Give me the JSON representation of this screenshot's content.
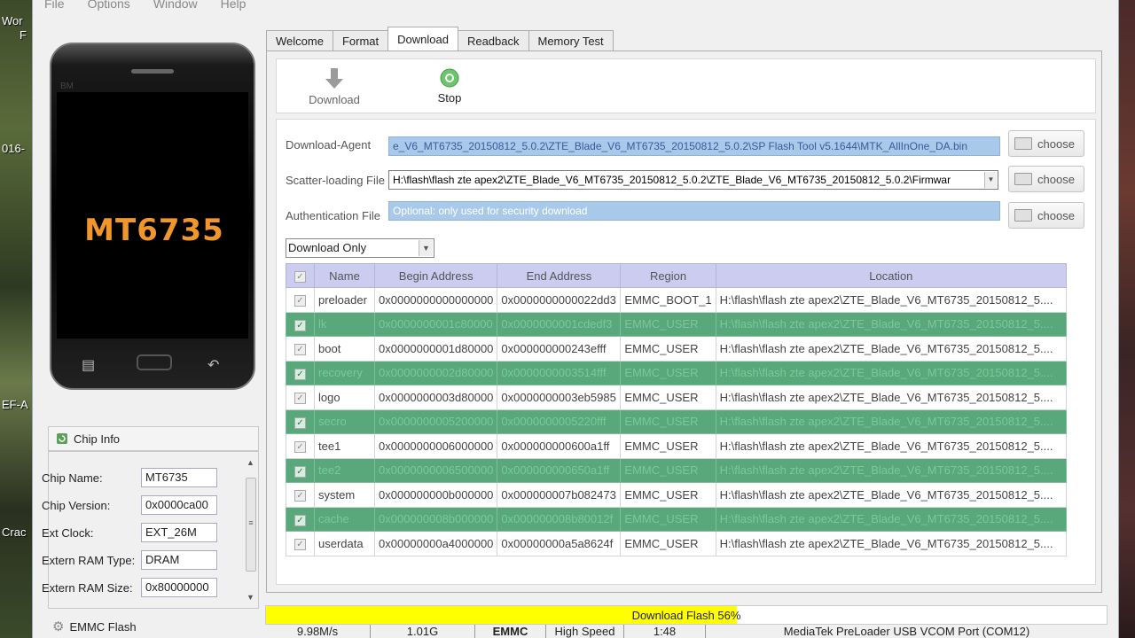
{
  "menu": [
    "File",
    "Options",
    "Window",
    "Help"
  ],
  "desktop": {
    "left_texts": [
      "Wor",
      "F",
      "016-",
      "EF-A",
      "Crac"
    ]
  },
  "phone": {
    "model": "MT6735",
    "brand": "BM"
  },
  "chip_info": {
    "title": "Chip Info",
    "fields": [
      {
        "label": "Chip Name:",
        "value": "MT6735"
      },
      {
        "label": "Chip Version:",
        "value": "0x0000ca00"
      },
      {
        "label": "Ext Clock:",
        "value": "EXT_26M"
      },
      {
        "label": "Extern RAM Type:",
        "value": "DRAM"
      },
      {
        "label": "Extern RAM Size:",
        "value": "0x80000000"
      }
    ]
  },
  "emmc_flash": "EMMC Flash",
  "tabs": [
    "Welcome",
    "Format",
    "Download",
    "Readback",
    "Memory Test"
  ],
  "active_tab": "Download",
  "toolbar": {
    "download": "Download",
    "stop": "Stop"
  },
  "form": {
    "download_agent_label": "Download-Agent",
    "download_agent_value": "e_V6_MT6735_20150812_5.0.2\\ZTE_Blade_V6_MT6735_20150812_5.0.2\\SP Flash Tool v5.1644\\MTK_AllInOne_DA.bin",
    "scatter_label": "Scatter-loading File",
    "scatter_value": "H:\\flash\\flash zte apex2\\ZTE_Blade_V6_MT6735_20150812_5.0.2\\ZTE_Blade_V6_MT6735_20150812_5.0.2\\Firmwar",
    "auth_label": "Authentication File",
    "auth_placeholder": "Optional: only used for security download",
    "choose": "choose",
    "mode": "Download Only"
  },
  "table": {
    "headers": [
      "Name",
      "Begin Address",
      "End Address",
      "Region",
      "Location"
    ],
    "rows": [
      {
        "name": "preloader",
        "begin": "0x0000000000000000",
        "end": "0x0000000000022dd3",
        "region": "EMMC_BOOT_1",
        "location": "H:\\flash\\flash zte apex2\\ZTE_Blade_V6_MT6735_20150812_5....",
        "selected": false
      },
      {
        "name": "lk",
        "begin": "0x0000000001c80000",
        "end": "0x0000000001cdedf3",
        "region": "EMMC_USER",
        "location": "H:\\flash\\flash zte apex2\\ZTE_Blade_V6_MT6735_20150812_5....",
        "selected": true
      },
      {
        "name": "boot",
        "begin": "0x0000000001d80000",
        "end": "0x000000000243efff",
        "region": "EMMC_USER",
        "location": "H:\\flash\\flash zte apex2\\ZTE_Blade_V6_MT6735_20150812_5....",
        "selected": false
      },
      {
        "name": "recovery",
        "begin": "0x0000000002d80000",
        "end": "0x0000000003514fff",
        "region": "EMMC_USER",
        "location": "H:\\flash\\flash zte apex2\\ZTE_Blade_V6_MT6735_20150812_5....",
        "selected": true
      },
      {
        "name": "logo",
        "begin": "0x0000000003d80000",
        "end": "0x0000000003eb5985",
        "region": "EMMC_USER",
        "location": "H:\\flash\\flash zte apex2\\ZTE_Blade_V6_MT6735_20150812_5....",
        "selected": false
      },
      {
        "name": "secro",
        "begin": "0x0000000005200000",
        "end": "0x0000000005220fff",
        "region": "EMMC_USER",
        "location": "H:\\flash\\flash zte apex2\\ZTE_Blade_V6_MT6735_20150812_5....",
        "selected": true
      },
      {
        "name": "tee1",
        "begin": "0x0000000006000000",
        "end": "0x000000000600a1ff",
        "region": "EMMC_USER",
        "location": "H:\\flash\\flash zte apex2\\ZTE_Blade_V6_MT6735_20150812_5....",
        "selected": false
      },
      {
        "name": "tee2",
        "begin": "0x0000000006500000",
        "end": "0x000000000650a1ff",
        "region": "EMMC_USER",
        "location": "H:\\flash\\flash zte apex2\\ZTE_Blade_V6_MT6735_20150812_5....",
        "selected": true
      },
      {
        "name": "system",
        "begin": "0x000000000b000000",
        "end": "0x000000007b082473",
        "region": "EMMC_USER",
        "location": "H:\\flash\\flash zte apex2\\ZTE_Blade_V6_MT6735_20150812_5....",
        "selected": false
      },
      {
        "name": "cache",
        "begin": "0x000000008b000000",
        "end": "0x000000008b80012f",
        "region": "EMMC_USER",
        "location": "H:\\flash\\flash zte apex2\\ZTE_Blade_V6_MT6735_20150812_5....",
        "selected": true
      },
      {
        "name": "userdata",
        "begin": "0x00000000a4000000",
        "end": "0x00000000a5a8624f",
        "region": "EMMC_USER",
        "location": "H:\\flash\\flash zte apex2\\ZTE_Blade_V6_MT6735_20150812_5....",
        "selected": false
      }
    ]
  },
  "progress": {
    "text": "Download Flash 56%",
    "percent": 56,
    "color": "#ffff00"
  },
  "status": {
    "speed": "9.98M/s",
    "size": "1.01G",
    "storage": "EMMC",
    "usb": "High Speed",
    "time": "1:48",
    "port": "MediaTek PreLoader USB VCOM Port (COM12)"
  },
  "colors": {
    "selected_row": "#58a87c",
    "header_bg": "#ccccf0",
    "path_field": "#a9c9ea"
  }
}
